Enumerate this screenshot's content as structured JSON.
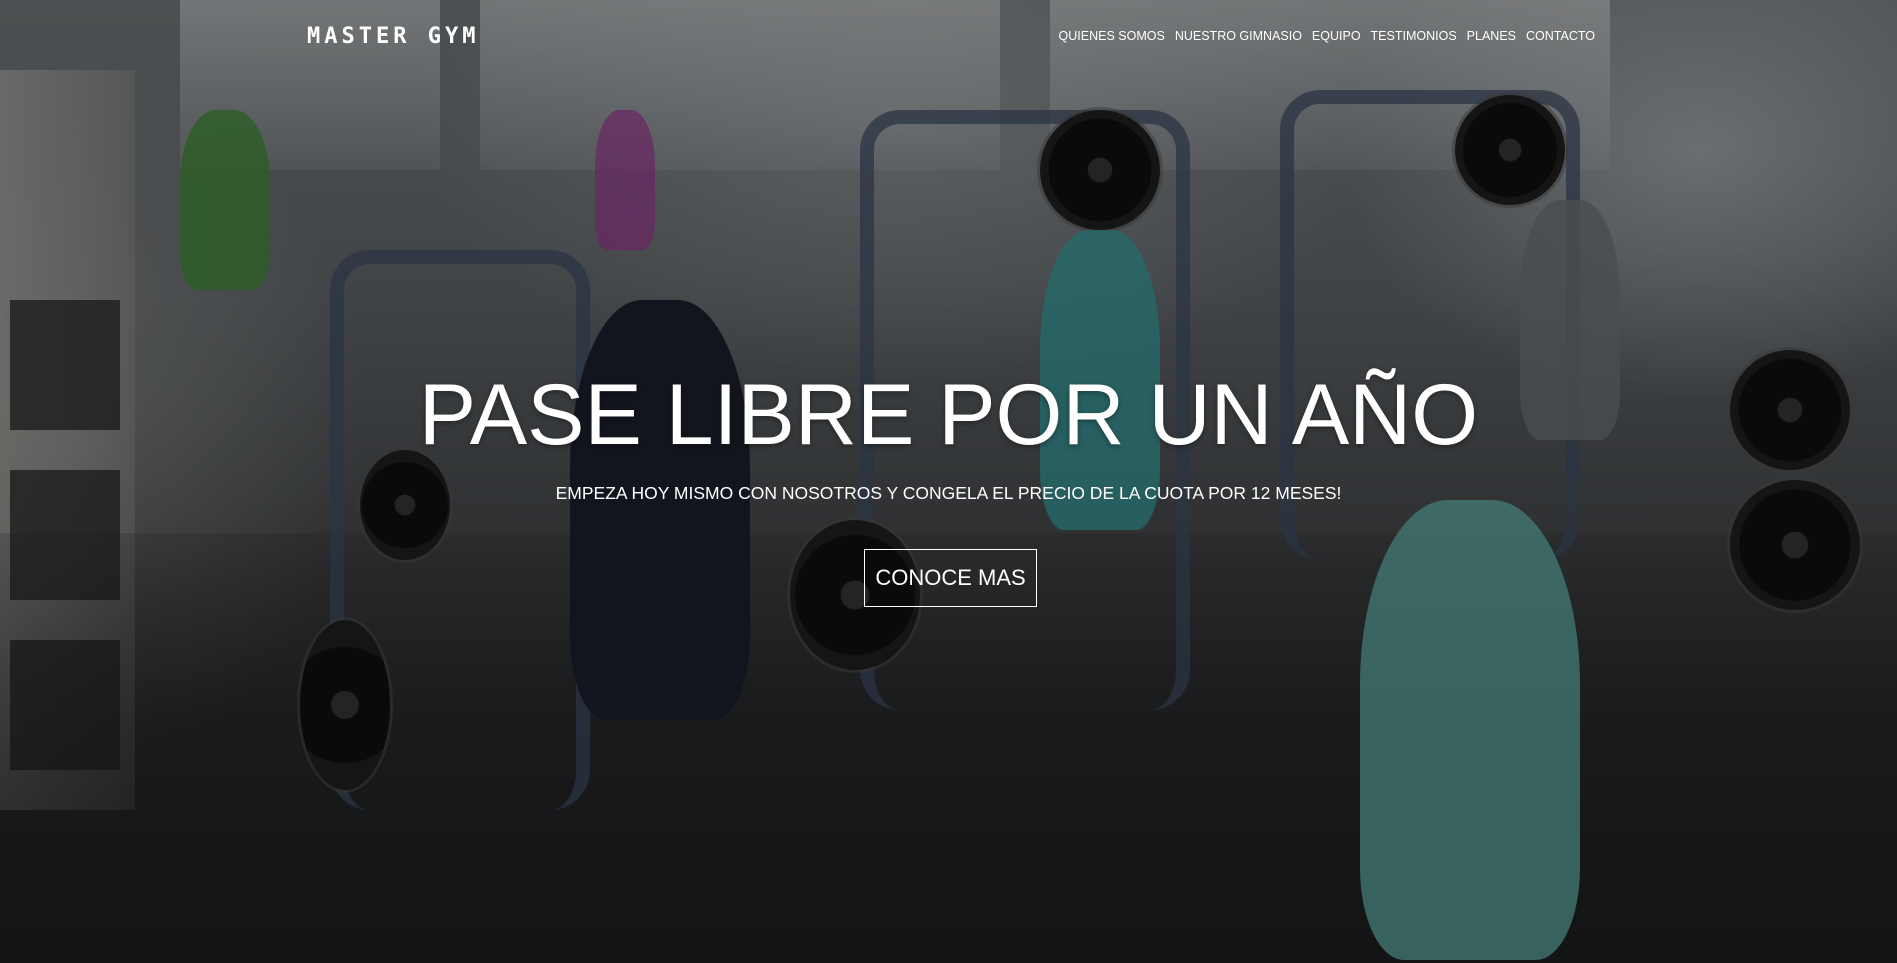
{
  "header": {
    "logo": "MASTER GYM",
    "nav": [
      {
        "label": "QUIENES SOMOS"
      },
      {
        "label": "NUESTRO GIMNASIO"
      },
      {
        "label": "EQUIPO"
      },
      {
        "label": "TESTIMONIOS"
      },
      {
        "label": "PLANES"
      },
      {
        "label": "CONTACTO"
      }
    ]
  },
  "hero": {
    "title": "PASE LIBRE POR UN AÑO",
    "subtitle": "EMPEZA HOY MISMO CON NOSOTROS Y CONGELA EL PRECIO DE LA CUOTA POR 12 MESES!",
    "cta_label": "CONOCE MAS"
  },
  "colors": {
    "text": "#ffffff",
    "overlay": "#000000"
  }
}
